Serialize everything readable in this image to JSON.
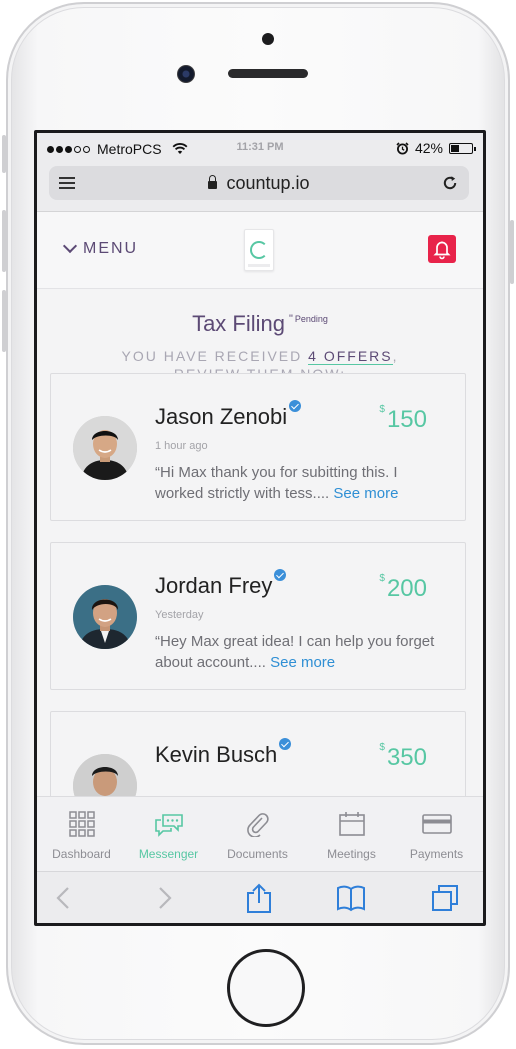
{
  "status_bar": {
    "carrier": "MetroPCS",
    "time": "11:31 PM",
    "battery_percent": "42%",
    "battery_level": 0.42,
    "icons": [
      "signal-dots-icon",
      "wifi-icon",
      "alarm-icon",
      "battery-icon"
    ]
  },
  "browser": {
    "url": "countup.io",
    "icons": [
      "menu-icon",
      "lock-icon",
      "reload-icon"
    ]
  },
  "header": {
    "menu_label": "MENU",
    "icons": [
      "chevron-down-icon",
      "countup-logo",
      "bell-icon"
    ],
    "accent": "#e8234a"
  },
  "page": {
    "title": "Tax Filing",
    "status_mark": "\"",
    "status": "Pending",
    "subtitle_pre": "YOU HAVE RECEIVED ",
    "subtitle_offers": "4 OFFERS",
    "subtitle_post": ",",
    "subtitle_line2": "REVIEW THEM NOW:"
  },
  "offers": [
    {
      "name": "Jason Zenobi",
      "currency": "$",
      "amount": "150",
      "time": "1 hour ago",
      "message": "“Hi Max thank you for subitting this. I worked strictly with tess....",
      "see_more": "See more"
    },
    {
      "name": "Jordan Frey",
      "currency": "$",
      "amount": "200",
      "time": "Yesterday",
      "message": "“Hey Max great idea! I can help you forget about account....",
      "see_more": "See more"
    },
    {
      "name": "Kevin Busch",
      "currency": "$",
      "amount": "350",
      "time": "",
      "message": "",
      "see_more": ""
    }
  ],
  "tabs": [
    {
      "label": "Dashboard",
      "icon": "grid-icon"
    },
    {
      "label": "Messenger",
      "icon": "chat-icon",
      "active": true
    },
    {
      "label": "Documents",
      "icon": "paperclip-icon"
    },
    {
      "label": "Meetings",
      "icon": "calendar-icon"
    },
    {
      "label": "Payments",
      "icon": "credit-card-icon"
    }
  ],
  "safari_toolbar": {
    "icons": [
      "back-icon",
      "forward-icon",
      "share-icon",
      "bookmarks-icon",
      "tabs-icon"
    ]
  },
  "colors": {
    "purple": "#5c4a75",
    "green": "#57c7a3",
    "link_blue": "#2f8fd4",
    "verified_blue": "#3b8fd9"
  }
}
